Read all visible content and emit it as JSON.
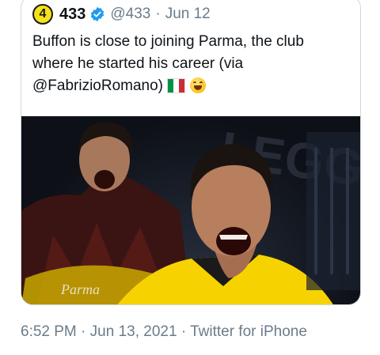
{
  "tweet": {
    "avatar_text": "4",
    "display_name": "433",
    "handle": "@433",
    "separator": "·",
    "date": "Jun 12",
    "text_line1": "Buffon is close to joining Parma, the club",
    "text_line2": "where he started his career (via",
    "text_line3": "@FabrizioRomano)",
    "media_alt": "Buffon in Parma and yellow goalkeeper kits, shouting",
    "jersey_text": "Parma",
    "background_text": "LEGGENDA"
  },
  "footer": {
    "time": "6:52 PM",
    "separator": "·",
    "date": "Jun 13, 2021",
    "separator2": "·",
    "source": "Twitter for iPhone"
  },
  "colors": {
    "verified": "#1d9bf0",
    "avatar": "#f4e21a",
    "parma_yellow": "#f6d200",
    "secondary_text": "#6b7c89"
  }
}
